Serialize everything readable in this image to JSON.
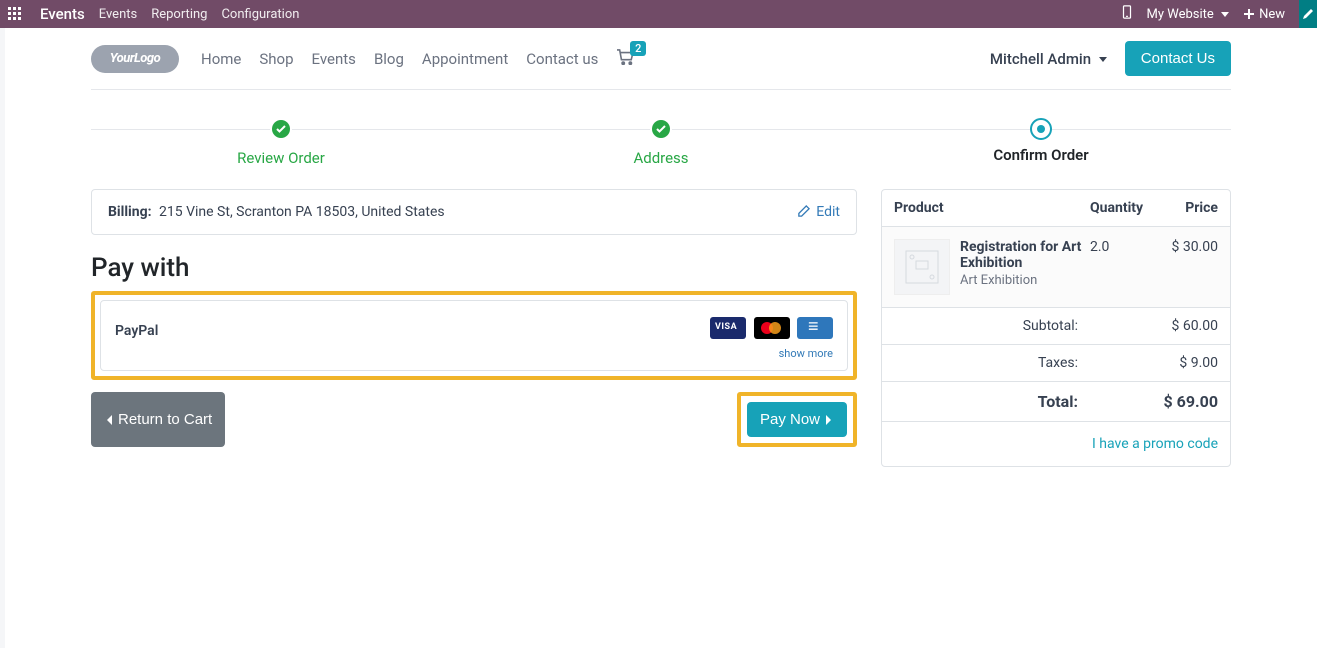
{
  "sysbar": {
    "brand": "Events",
    "menu": [
      "Events",
      "Reporting",
      "Configuration"
    ],
    "website_switch": "My Website",
    "new": "New"
  },
  "site": {
    "nav": [
      "Home",
      "Shop",
      "Events",
      "Blog",
      "Appointment",
      "Contact us"
    ],
    "cart_count": "2",
    "user": "Mitchell Admin",
    "contact": "Contact Us",
    "logo_text": "YourLogo"
  },
  "wizard": {
    "step1": "Review Order",
    "step2": "Address",
    "step3": "Confirm Order"
  },
  "billing": {
    "label": "Billing:",
    "address": "215 Vine St, Scranton PA 18503, United States",
    "edit": "Edit"
  },
  "payment": {
    "heading": "Pay with",
    "option_name": "PayPal",
    "show_more": "show more"
  },
  "actions": {
    "return": "Return to Cart",
    "paynow": "Pay Now"
  },
  "summary": {
    "hdr_product": "Product",
    "hdr_qty": "Quantity",
    "hdr_price": "Price",
    "item": {
      "title": "Registration for Art Exhibition",
      "sub": "Art Exhibition",
      "qty": "2.0",
      "price": "$ 30.00"
    },
    "subtotal_lbl": "Subtotal:",
    "subtotal_val": "$ 60.00",
    "taxes_lbl": "Taxes:",
    "taxes_val": "$ 9.00",
    "total_lbl": "Total:",
    "total_val": "$ 69.00",
    "promo": "I have a promo code"
  }
}
